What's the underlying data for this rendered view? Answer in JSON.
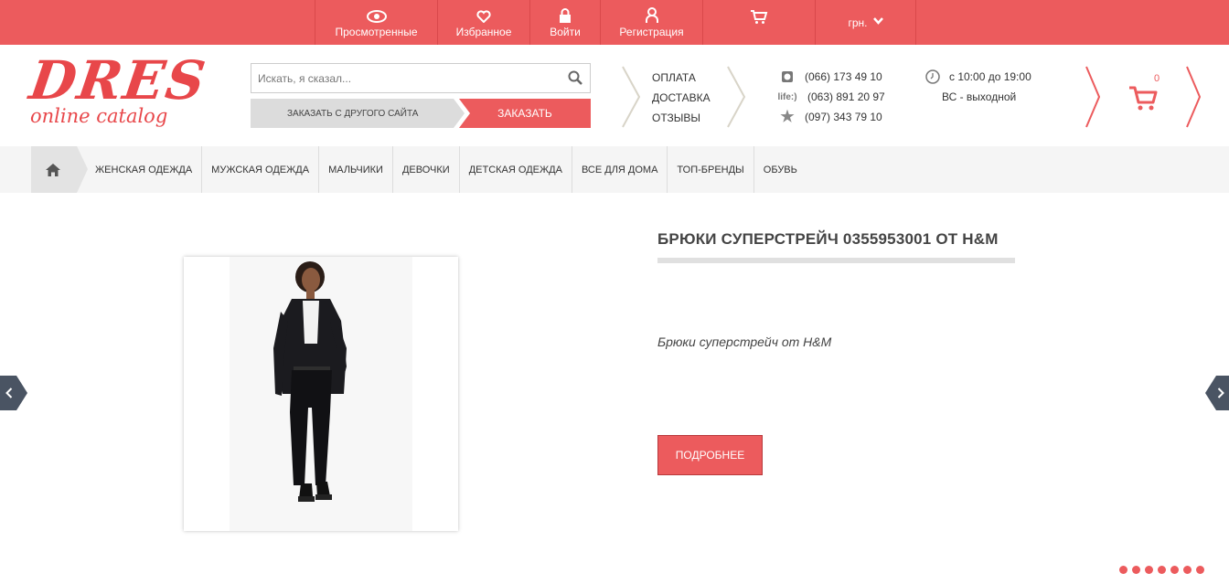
{
  "colors": {
    "accent": "#ec5b5d",
    "dark_arrow": "#4a5463"
  },
  "topnav": {
    "viewed": "Просмотренные",
    "favorites": "Избранное",
    "login": "Войти",
    "register": "Регистрация",
    "currency": "грн."
  },
  "logo": {
    "big": "DRES",
    "small": "online catalog"
  },
  "search": {
    "placeholder": "Искать, я сказал..."
  },
  "buttons": {
    "order_other": "ЗАКАЗАТЬ С ДРУГОГО САЙТА",
    "order": "ЗАКАЗАТЬ"
  },
  "info_links": [
    "ОПЛАТА",
    "ДОСТАВКА",
    "ОТЗЫВЫ"
  ],
  "phones": [
    "(066) 173 49 10",
    "(063) 891 20 97",
    "(097) 343 79 10"
  ],
  "phone_icon_life": "life:)",
  "hours": {
    "time": "с 10:00 до 19:00",
    "weekend": "ВС - выходной"
  },
  "cart": {
    "count": "0"
  },
  "menu": [
    "ЖЕНСКАЯ ОДЕЖДА",
    "МУЖСКАЯ ОДЕЖДА",
    "МАЛЬЧИКИ",
    "ДЕВОЧКИ",
    "ДЕТСКАЯ ОДЕЖДА",
    "ВСЕ ДЛЯ ДОМА",
    "ТОП-БРЕНДЫ",
    "ОБУВЬ"
  ],
  "product": {
    "title": "БРЮКИ СУПЕРСТРЕЙЧ 0355953001 ОТ H&M",
    "description": "Брюки суперстрейч от H&M",
    "more": "ПОДРОБНЕЕ"
  },
  "slider": {
    "dots": 7
  }
}
